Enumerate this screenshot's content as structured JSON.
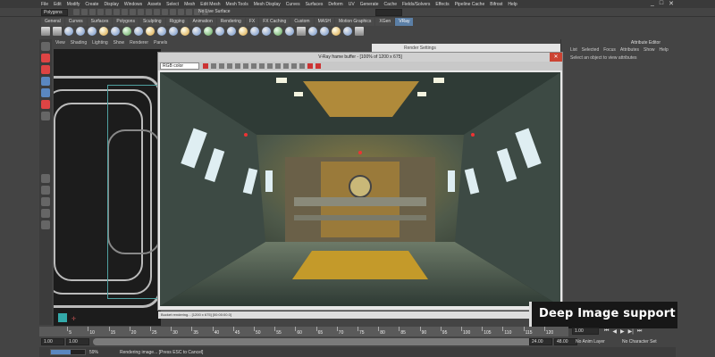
{
  "menubar": {
    "items": [
      "File",
      "Edit",
      "Modify",
      "Create",
      "Display",
      "Windows",
      "Assets",
      "Select",
      "Mesh",
      "Edit Mesh",
      "Mesh Tools",
      "Mesh Display",
      "Curves",
      "Surfaces",
      "Deform",
      "UV",
      "Generate",
      "Cache",
      "Fields/Solvers",
      "Effects",
      "Pipeline Cache",
      "Bifrost",
      "Help"
    ]
  },
  "statusline": {
    "mode": "Polygons",
    "live_surface": "No Live Surface"
  },
  "shelf": {
    "tabs": [
      "General",
      "Curves",
      "Surfaces",
      "Polygons",
      "Sculpting",
      "Rigging",
      "Animation",
      "Rendering",
      "FX",
      "FX Caching",
      "Custom",
      "MASH",
      "Motion Graphics",
      "XGen",
      "VRay"
    ],
    "active_tab": "VRay"
  },
  "panel": {
    "menu": [
      "View",
      "Shading",
      "Lighting",
      "Show",
      "Renderer",
      "Panels"
    ]
  },
  "vray_window": {
    "title": "V-Ray frame buffer - [100% of 1200 x 675]",
    "channel": "RGB color",
    "status": "Bucket rendering... [1200 x 675] [00:00:00.0]"
  },
  "render_settings": {
    "title": "Render Settings"
  },
  "attribute_editor": {
    "title": "Attribute Editor",
    "menu": [
      "List",
      "Selected",
      "Focus",
      "Attributes",
      "Show",
      "Help"
    ],
    "hint": "Select an object to view attributes"
  },
  "caption": {
    "text": "Deep Image support"
  },
  "timeline": {
    "ticks": [
      "5",
      "10",
      "15",
      "20",
      "25",
      "30",
      "35",
      "40",
      "45",
      "50",
      "55",
      "60",
      "65",
      "70",
      "75",
      "80",
      "85",
      "90",
      "95",
      "100",
      "105",
      "110",
      "115",
      "120"
    ],
    "current_frame": "1.00"
  },
  "range": {
    "start": "1.00",
    "start2": "1.00",
    "end": "24.00",
    "end2": "48.00",
    "field": "1",
    "field_end": "120"
  },
  "status": {
    "progress_percent": 59,
    "progress_label": "59%",
    "message": "Rendering image... [Press ESC to Cancel]",
    "anim_layer": "No Anim Layer",
    "char_set": "No Character Set"
  },
  "colors": {
    "accent": "#5b7fa6",
    "caption_bg": "#171717"
  }
}
